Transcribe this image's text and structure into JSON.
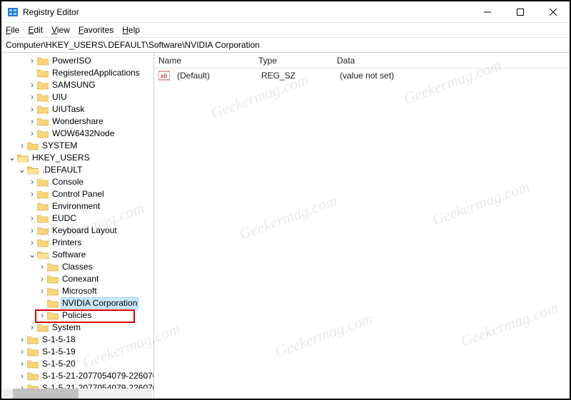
{
  "window": {
    "title": "Registry Editor",
    "minimize": "—",
    "maximize": "□",
    "close": "✕"
  },
  "menu": {
    "file": "File",
    "edit": "Edit",
    "view": "View",
    "favorites": "Favorites",
    "help": "Help"
  },
  "address": "Computer\\HKEY_USERS\\.DEFAULT\\Software\\NVIDIA Corporation",
  "cols": {
    "name": "Name",
    "type": "Type",
    "data": "Data"
  },
  "value_row": {
    "name": "(Default)",
    "type": "REG_SZ",
    "data": "(value not set)"
  },
  "tree": {
    "poweriso": "PowerISO",
    "regapps": "RegisteredApplications",
    "samsung": "SAMSUNG",
    "uiu": "UIU",
    "uiutask": "UIUTask",
    "wondershare": "Wondershare",
    "wow64": "WOW6432Node",
    "system": "SYSTEM",
    "hkusers": "HKEY_USERS",
    "default": ".DEFAULT",
    "console": "Console",
    "cpanel": "Control Panel",
    "env": "Environment",
    "eudc": "EUDC",
    "kb": "Keyboard Layout",
    "printers": "Printers",
    "software": "Software",
    "classes": "Classes",
    "conexant": "Conexant",
    "microsoft": "Microsoft",
    "nvidia": "NVIDIA Corporation",
    "policies": "Policies",
    "system2": "System",
    "s1518": "S-1-5-18",
    "s1519": "S-1-5-19",
    "s1520": "S-1-5-20",
    "s15a": "S-1-5-21-2077054079-226070",
    "s15b": "S-1-5-21-2077054079-226070"
  },
  "watermark": "Geekermag.com"
}
